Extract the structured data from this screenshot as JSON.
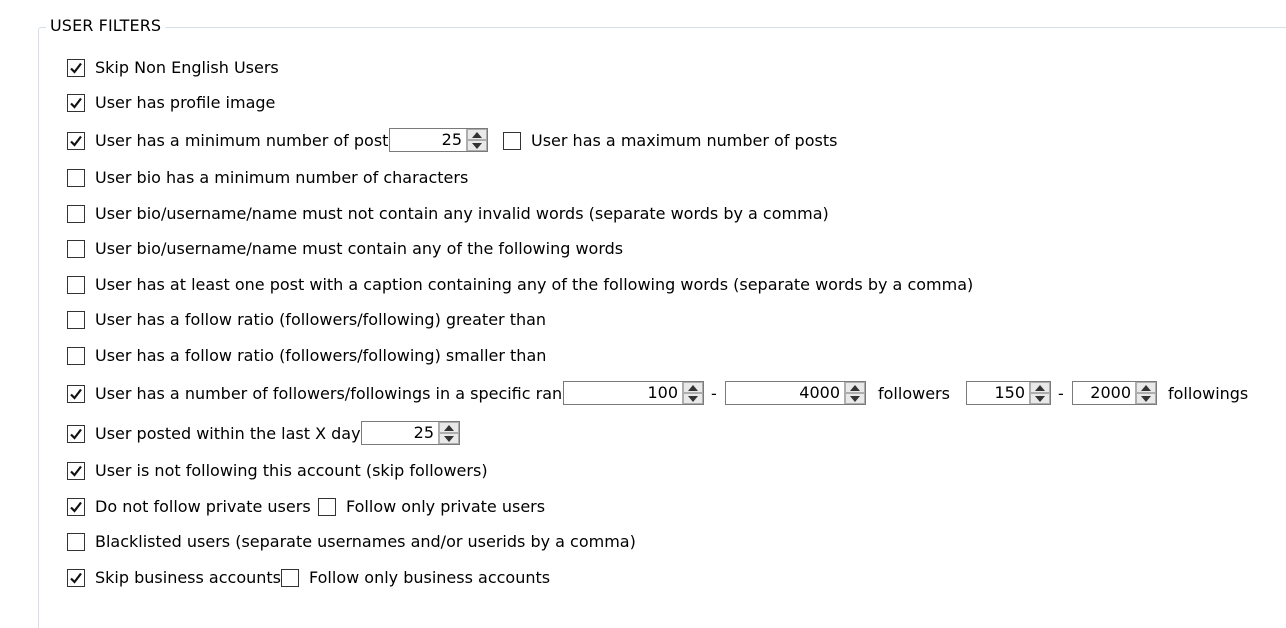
{
  "group": {
    "title": "USER FILTERS"
  },
  "filters": [
    {
      "label": "Skip Non English Users",
      "checked": true
    },
    {
      "label": "User has profile image",
      "checked": true
    },
    {
      "label": "User has a minimum number of posts",
      "checked": true
    },
    {
      "label": "User bio has a minimum number of characters",
      "checked": false
    },
    {
      "label": "User bio/username/name must not contain any invalid words (separate words by a comma)",
      "checked": false
    },
    {
      "label": "User bio/username/name must contain any of the following words",
      "checked": false
    },
    {
      "label": "User has at least one post with a caption containing any of the following words (separate words by a comma)",
      "checked": false
    },
    {
      "label": "User has a follow ratio (followers/following) greater than",
      "checked": false
    },
    {
      "label": "User has a follow ratio (followers/following) smaller than",
      "checked": false
    },
    {
      "label": "User has a number of followers/followings in a specific range",
      "checked": true
    },
    {
      "label": "User posted within the last X days",
      "checked": true
    },
    {
      "label": "User is not following this account (skip followers)",
      "checked": true
    },
    {
      "label": "Do not follow private users",
      "checked": true
    },
    {
      "label": "Blacklisted users (separate usernames and/or userids by a comma)",
      "checked": false
    },
    {
      "label": "Skip business accounts",
      "checked": true
    }
  ],
  "max_posts": {
    "label": "User has a maximum number of posts",
    "checked": false
  },
  "only_private": {
    "label": "Follow only private users",
    "checked": false
  },
  "only_business": {
    "label": "Follow only business accounts",
    "checked": false
  },
  "min_posts_value": "25",
  "followers_range": {
    "min": "100",
    "separator": "-",
    "max": "4000",
    "unit": "followers"
  },
  "followings_range": {
    "min": "150",
    "separator": "-",
    "max": "2000",
    "unit": "followings"
  },
  "posted_days_value": "25"
}
